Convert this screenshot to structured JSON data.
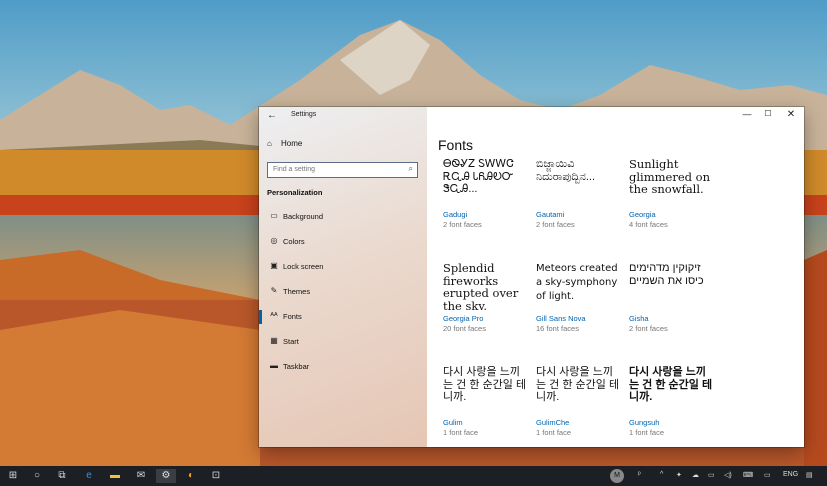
{
  "window": {
    "title": "Settings",
    "back_icon": "back-arrow-icon",
    "minimize_glyph": "—",
    "maximize_glyph": "☐",
    "close_glyph": "✕"
  },
  "nav": {
    "home_label": "Home",
    "search_placeholder": "Find a setting",
    "section_label": "Personalization",
    "items": [
      {
        "label": "Background",
        "icon": "picture-icon",
        "glyph": "▭"
      },
      {
        "label": "Colors",
        "icon": "palette-icon",
        "glyph": "◎"
      },
      {
        "label": "Lock screen",
        "icon": "lock-screen-icon",
        "glyph": "▣"
      },
      {
        "label": "Themes",
        "icon": "brush-icon",
        "glyph": "✎"
      },
      {
        "label": "Fonts",
        "icon": "fonts-icon",
        "glyph": "ᴬᴬ"
      },
      {
        "label": "Start",
        "icon": "start-grid-icon",
        "glyph": "▦"
      },
      {
        "label": "Taskbar",
        "icon": "taskbar-icon",
        "glyph": "▬"
      }
    ],
    "selected": "Fonts"
  },
  "content": {
    "title": "Fonts",
    "fonts": [
      {
        "sample": "ᎾᏫᎽᏃ ᏚᎳᎳᏣ ᎡᏩᎯ ᏓᏲᎯᎧᏅ ᏕᏩᎯ...",
        "name": "Gadugi",
        "faces": "2 font faces"
      },
      {
        "sample": "ಬಿಜ್ಜಾಯಿವಿ ನಿದುರಾಪುದ್ಬಿನ...",
        "name": "Gautami",
        "faces": "2 font faces"
      },
      {
        "sample": "Sunlight glimmered on the snowfall.",
        "name": "Georgia",
        "faces": "4 font faces"
      },
      {
        "sample": "Splendid fireworks erupted over the sky.",
        "name": "Georgia Pro",
        "faces": "20 font faces"
      },
      {
        "sample": "Meteors created a sky-symphony of light.",
        "name": "Gill Sans Nova",
        "faces": "16 font faces"
      },
      {
        "sample": "זיקוקין מדהימים כיסו את השמיים",
        "name": "Gisha",
        "faces": "2 font faces"
      },
      {
        "sample": "다시 사랑을 느끼는 건 한 순간일 테니까.",
        "name": "Gulim",
        "faces": "1 font face"
      },
      {
        "sample": "다시 사랑을 느끼는 건 한 순간일 테니까.",
        "name": "GulimChe",
        "faces": "1 font face"
      },
      {
        "sample": "다시 사랑을 느끼는 건 한 순간일 테니까.",
        "name": "Gungsuh",
        "faces": "1 font face"
      }
    ]
  },
  "taskbar": {
    "language": "ENG",
    "apps": [
      "windows-logo-icon",
      "cortana-icon",
      "task-view-icon",
      "edge-icon",
      "file-explorer-icon",
      "mail-icon",
      "settings-icon",
      "paint-icon",
      "store-icon"
    ]
  }
}
